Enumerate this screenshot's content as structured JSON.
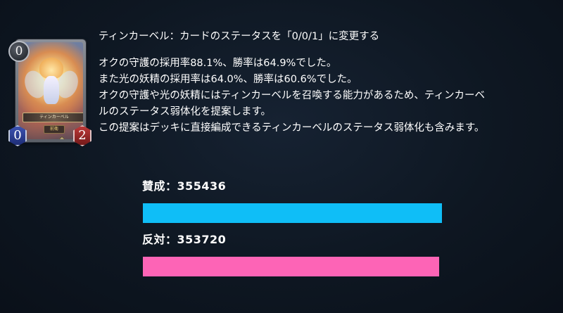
{
  "card": {
    "name": "ティンカーベル",
    "class_label": "前衛",
    "cost": "0",
    "attack": "0",
    "defense": "2"
  },
  "proposal": {
    "heading": "ティンカーベル：カードのステータスを「0/0/1」に変更する",
    "lines": [
      "オクの守護の採用率88.1%、勝率は64.9%でした。",
      "また光の妖精の採用率は64.0%、勝率は60.6%でした。",
      "オクの守護や光の妖精にはティンカーベルを召喚する能力があるため、ティンカーベ",
      "ルのステータス弱体化を提案します。",
      "この提案はデッキに直接編成できるティンカーベルのステータス弱体化も含みます。"
    ]
  },
  "votes": {
    "agree_label": "賛成：355436",
    "oppose_label": "反対：353720",
    "agree_count": 355436,
    "oppose_count": 353720,
    "agree_color": "#0fbef7",
    "oppose_color": "#fd64b6"
  },
  "colors": {
    "background": "#0e1722",
    "text": "#ffffff"
  }
}
